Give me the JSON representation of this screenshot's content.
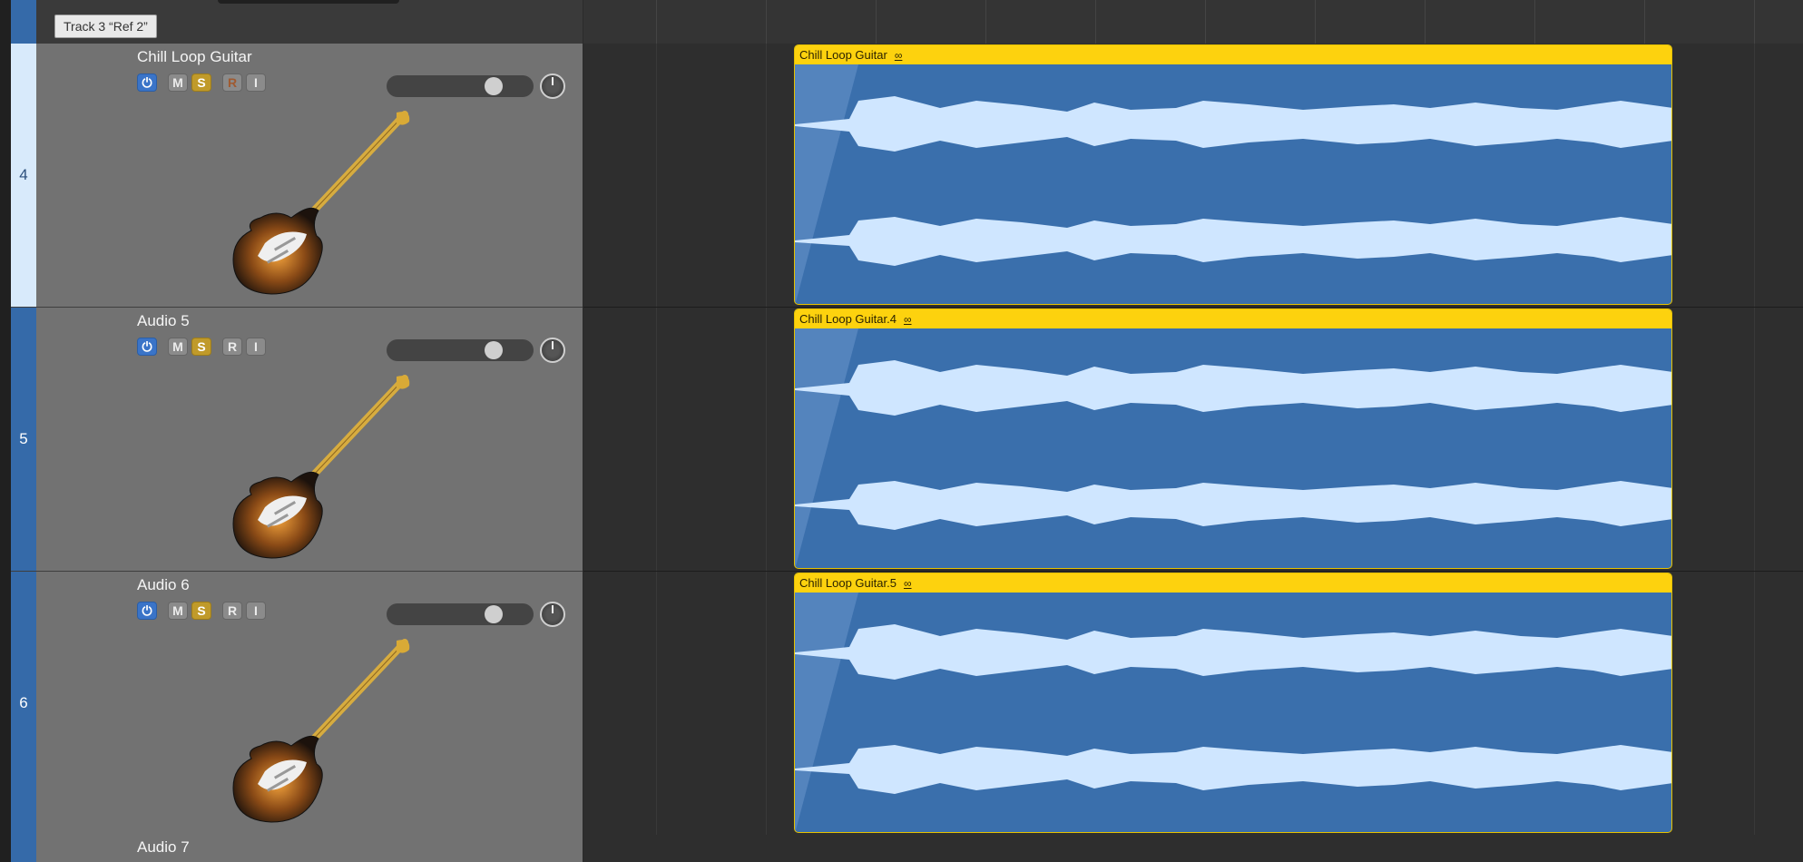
{
  "tooltip": "Track 3 “Ref 2”",
  "tracks": [
    {
      "number": "4",
      "name": "Chill Loop Guitar",
      "selected": true,
      "region": "Chill Loop Guitar",
      "buttons": {
        "mute": "M",
        "solo": "S",
        "record": "R",
        "input": "I"
      }
    },
    {
      "number": "5",
      "name": "Audio 5",
      "selected": false,
      "region": "Chill Loop Guitar.4",
      "buttons": {
        "mute": "M",
        "solo": "S",
        "record": "R",
        "input": "I"
      }
    },
    {
      "number": "6",
      "name": "Audio 6",
      "selected": false,
      "region": "Chill Loop Guitar.5",
      "buttons": {
        "mute": "M",
        "solo": "S",
        "record": "R",
        "input": "I"
      }
    },
    {
      "number": "",
      "name": "Audio 7",
      "selected": false
    }
  ],
  "colors": {
    "accent": "#356aa9",
    "region_header": "#fdd20e",
    "region_body": "#3a6fac",
    "waveform": "#cfe6ff",
    "solo": "#c09a2a",
    "power": "#3a74c8"
  },
  "icons": {
    "power": "power-icon",
    "loop": "loop-icon",
    "guitar": "electric-guitar-icon"
  }
}
